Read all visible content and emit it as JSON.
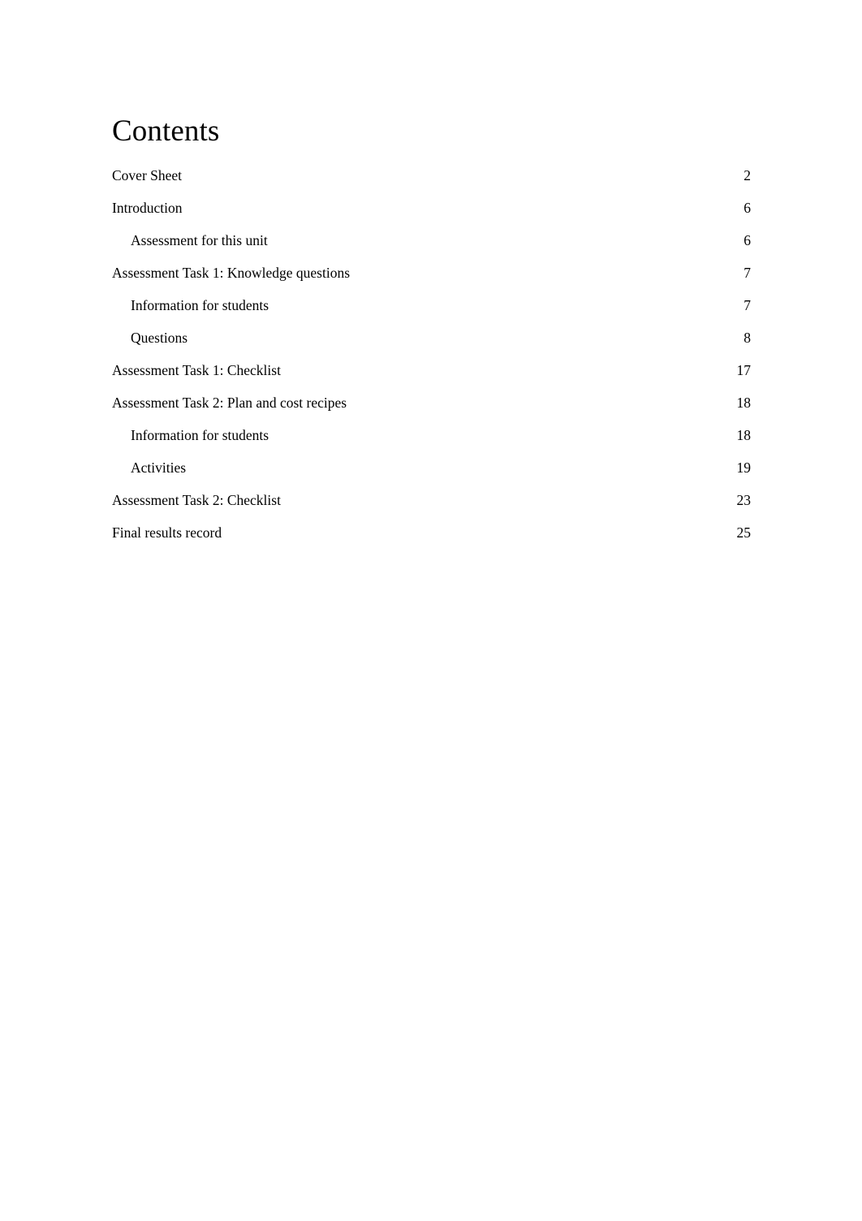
{
  "document": {
    "title": "Contents"
  },
  "toc": {
    "entries": [
      {
        "label": "Cover Sheet",
        "page": "2",
        "level": 1
      },
      {
        "label": "Introduction",
        "page": "6",
        "level": 1
      },
      {
        "label": "Assessment for this unit",
        "page": "6",
        "level": 2
      },
      {
        "label": "Assessment Task 1: Knowledge questions",
        "page": "7",
        "level": 1
      },
      {
        "label": "Information for students",
        "page": "7",
        "level": 2
      },
      {
        "label": "Questions",
        "page": "8",
        "level": 2
      },
      {
        "label": "Assessment Task 1: Checklist",
        "page": "17",
        "level": 1
      },
      {
        "label": "Assessment Task 2: Plan and cost recipes",
        "page": "18",
        "level": 1
      },
      {
        "label": "Information for students",
        "page": "18",
        "level": 2
      },
      {
        "label": "Activities",
        "page": "19",
        "level": 2
      },
      {
        "label": "Assessment Task 2: Checklist",
        "page": "23",
        "level": 1
      },
      {
        "label": "Final results record",
        "page": "25",
        "level": 1
      }
    ]
  }
}
